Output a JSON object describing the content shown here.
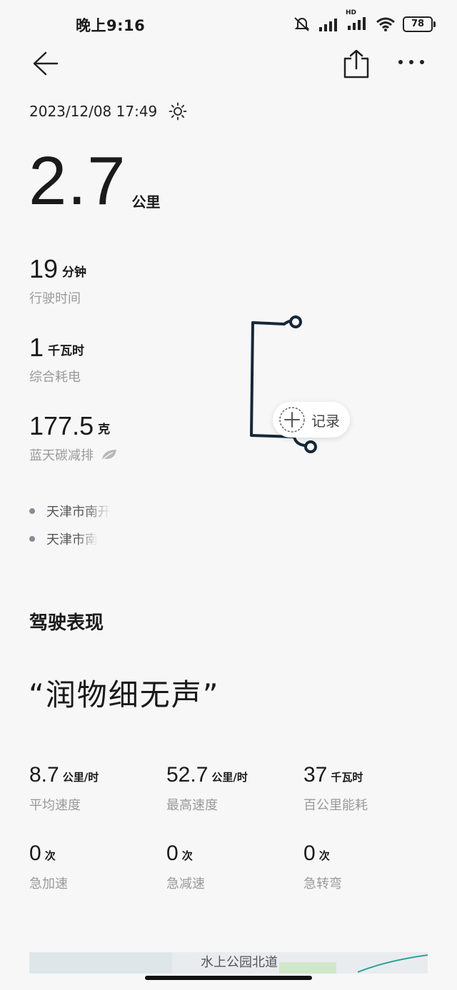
{
  "status_bar": {
    "time": "晚上9:16",
    "battery": "78",
    "network_badge": "HD"
  },
  "header": {
    "back_icon": "arrow-left-icon",
    "share_icon": "share-icon",
    "more_icon": "more-horizontal-icon"
  },
  "trip": {
    "datetime": "2023/12/08 17:49",
    "weather_icon": "sun-icon",
    "distance": {
      "value": "2.7",
      "unit": "公里"
    },
    "stats": [
      {
        "value": "19",
        "unit": "分钟",
        "label": "行驶时间"
      },
      {
        "value": "1",
        "unit": "千瓦时",
        "label": "综合耗电"
      },
      {
        "value": "177.5",
        "unit": "克",
        "label": "蓝天碳减排",
        "icon": "leaf-icon"
      }
    ],
    "record_button": "记录",
    "locations": [
      "天津市南开",
      "天津市南"
    ]
  },
  "performance": {
    "title": "驾驶表现",
    "quote": "“润物细无声”",
    "metrics": [
      {
        "value": "8.7",
        "unit": "公里/时",
        "label": "平均速度"
      },
      {
        "value": "52.7",
        "unit": "公里/时",
        "label": "最高速度"
      },
      {
        "value": "37",
        "unit": "千瓦时",
        "label": "百公里能耗"
      },
      {
        "value": "0",
        "unit": "次",
        "label": "急加速"
      },
      {
        "value": "0",
        "unit": "次",
        "label": "急减速"
      },
      {
        "value": "0",
        "unit": "次",
        "label": "急转弯"
      }
    ]
  },
  "map_strip": {
    "road_label": "水上公园北道"
  },
  "colors": {
    "background": "#f7f7f7",
    "route": "#14283a",
    "label_gray": "#9a9a9a"
  }
}
